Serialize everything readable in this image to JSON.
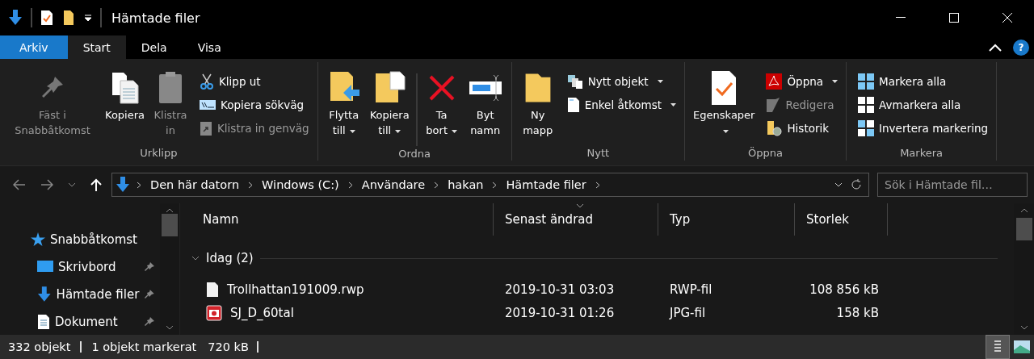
{
  "window": {
    "title": "Hämtade filer"
  },
  "ribbon": {
    "tabs": [
      {
        "label": "Arkiv",
        "kind": "file",
        "selected": false
      },
      {
        "label": "Start",
        "kind": "tab",
        "selected": true
      },
      {
        "label": "Dela",
        "kind": "tab",
        "selected": false
      },
      {
        "label": "Visa",
        "kind": "tab",
        "selected": false
      }
    ],
    "help": "?",
    "groups": [
      {
        "label": "Urklipp",
        "items": [
          {
            "kind": "large",
            "label": "Fäst i Snabbåtkomst",
            "disabled": true,
            "dropdown": false
          },
          {
            "kind": "large",
            "label": "Kopiera",
            "disabled": false,
            "dropdown": false
          },
          {
            "kind": "large",
            "label": "Klistra in",
            "disabled": true,
            "dropdown": false
          },
          {
            "kind": "small",
            "label": "Klipp ut",
            "disabled": false,
            "dropdown": false
          },
          {
            "kind": "small",
            "label": "Kopiera sökväg",
            "disabled": false,
            "dropdown": false
          },
          {
            "kind": "small",
            "label": "Klistra in genväg",
            "disabled": true,
            "dropdown": false
          }
        ]
      },
      {
        "label": "Ordna",
        "items": [
          {
            "kind": "large",
            "label": "Flytta till",
            "disabled": false,
            "dropdown": true
          },
          {
            "kind": "large",
            "label": "Kopiera till",
            "disabled": false,
            "dropdown": true
          },
          {
            "kind": "separator"
          },
          {
            "kind": "large",
            "label": "Ta bort",
            "disabled": false,
            "dropdown": true
          },
          {
            "kind": "large",
            "label": "Byt namn",
            "disabled": false,
            "dropdown": false
          }
        ]
      },
      {
        "label": "Nytt",
        "items": [
          {
            "kind": "large",
            "label": "Ny mapp",
            "disabled": false,
            "dropdown": false
          },
          {
            "kind": "small",
            "label": "Nytt objekt",
            "disabled": false,
            "dropdown": true
          },
          {
            "kind": "small",
            "label": "Enkel åtkomst",
            "disabled": false,
            "dropdown": true
          }
        ]
      },
      {
        "label": "Öppna",
        "items": [
          {
            "kind": "large",
            "label": "Egenskaper",
            "disabled": false,
            "dropdown": true
          },
          {
            "kind": "small",
            "label": "Öppna",
            "disabled": false,
            "dropdown": true
          },
          {
            "kind": "small",
            "label": "Redigera",
            "disabled": true,
            "dropdown": false
          },
          {
            "kind": "small",
            "label": "Historik",
            "disabled": false,
            "dropdown": false
          }
        ]
      },
      {
        "label": "Markera",
        "items": [
          {
            "kind": "small",
            "label": "Markera alla",
            "disabled": false,
            "dropdown": false
          },
          {
            "kind": "small",
            "label": "Avmarkera alla",
            "disabled": false,
            "dropdown": false
          },
          {
            "kind": "small",
            "label": "Invertera markering",
            "disabled": false,
            "dropdown": false
          }
        ]
      }
    ]
  },
  "address_bar": {
    "path": [
      "Den här datorn",
      "Windows (C:)",
      "Användare",
      "hakan",
      "Hämtade filer"
    ],
    "search": {
      "placeholder": "Sök i Hämtade fil…"
    }
  },
  "navigation_pane": {
    "items": [
      {
        "label": "Snabbåtkomst",
        "pinned": false,
        "children": [
          {
            "label": "Skrivbord",
            "pinned": true
          },
          {
            "label": "Hämtade filer",
            "pinned": true
          },
          {
            "label": "Dokument",
            "pinned": true
          }
        ]
      }
    ]
  },
  "file_list": {
    "columns": [
      {
        "label": "Namn",
        "sorted": false
      },
      {
        "label": "Senast ändrad",
        "sorted": true
      },
      {
        "label": "Typ",
        "sorted": false
      },
      {
        "label": "Storlek",
        "sorted": false
      }
    ],
    "groups": [
      {
        "label": "Idag (2)",
        "expanded": true,
        "rows": [
          {
            "kind": "document",
            "name": "Trollhattan191009.rwp",
            "modified": "2019-10-31 03:03",
            "type": "RWP-fil",
            "size": "108 856 kB"
          },
          {
            "kind": "image",
            "name": "SJ_D_60tal",
            "modified": "2019-10-31 01:26",
            "type": "JPG-fil",
            "size": "158 kB"
          }
        ]
      }
    ]
  },
  "status_bar": {
    "items": [
      "332 objekt",
      "1 objekt markerat",
      "720 kB"
    ],
    "views": [
      {
        "selected": true
      },
      {
        "selected": false
      }
    ]
  }
}
